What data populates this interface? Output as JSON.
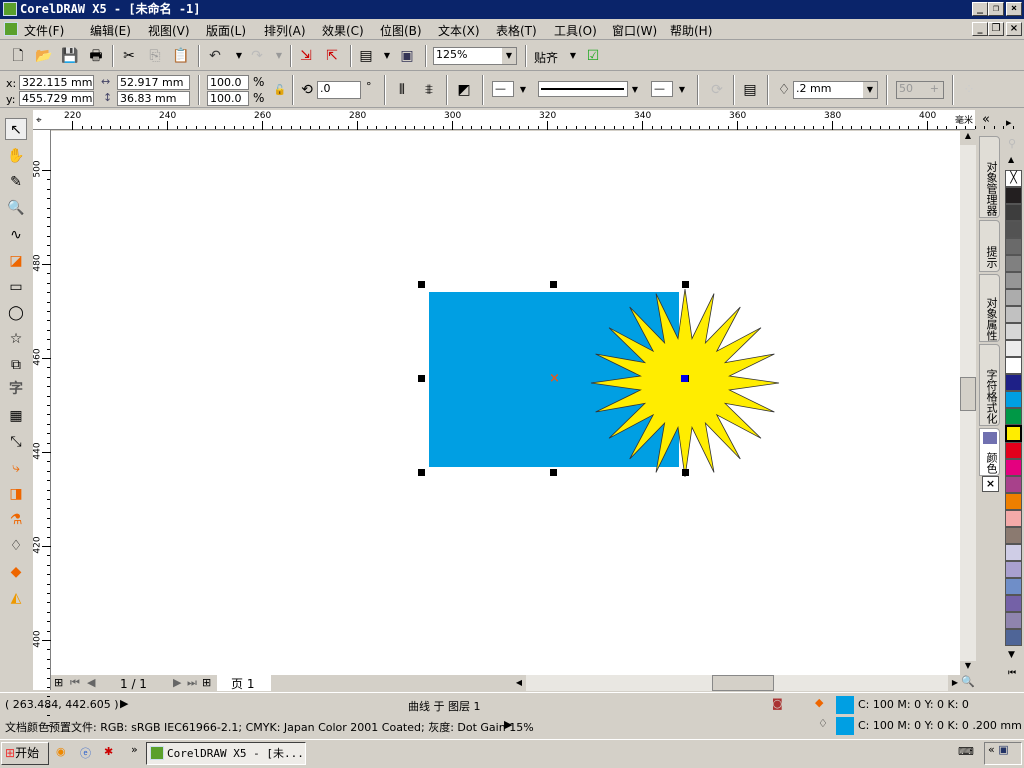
{
  "window": {
    "title": "CorelDRAW X5 - [未命名 -1]"
  },
  "menu": [
    "文件(F)",
    "编辑(E)",
    "视图(V)",
    "版面(L)",
    "排列(A)",
    "效果(C)",
    "位图(B)",
    "文本(X)",
    "表格(T)",
    "工具(O)",
    "窗口(W)",
    "帮助(H)"
  ],
  "toolbar": {
    "zoom": "125%",
    "snap": "贴齐"
  },
  "property_bar": {
    "x_label": "x:",
    "x": "322.115 mm",
    "y_label": "y:",
    "y": "455.729 mm",
    "width": "52.917 mm",
    "height": "36.83 mm",
    "scale_x": "100.0",
    "scale_y": "100.0",
    "pct": "%",
    "rotation": ".0",
    "deg": "°",
    "outline_width": ".2 mm",
    "points": "50"
  },
  "ruler": {
    "unit": "毫米",
    "top_ticks": [
      "220",
      "240",
      "260",
      "280",
      "300",
      "320",
      "340",
      "360",
      "380",
      "400"
    ],
    "left_ticks": [
      "500",
      "480",
      "460",
      "440",
      "420",
      "400"
    ]
  },
  "page_nav": {
    "count": "1 / 1",
    "tab": "页 1"
  },
  "docker_tabs": [
    "对象管理器",
    "提示",
    "对象属性",
    "字符格式化",
    "颜色"
  ],
  "palette": {
    "colors": [
      "#231f20",
      "#3d3d3d",
      "#535353",
      "#6a6a6a",
      "#808080",
      "#969696",
      "#acacac",
      "#c1c1c1",
      "#d7d7d7",
      "#ececec",
      "#ffffff",
      "#1e2087",
      "#009fe3",
      "#009846",
      "#ffed00",
      "#e3001b",
      "#e4007f",
      "#a8418b",
      "#ee7f00",
      "#f4aaa9",
      "#8b7a70",
      "#cfcde6",
      "#a9a0cf",
      "#6f8ec8",
      "#7461a7",
      "#8f84ae",
      "#4f6597"
    ]
  },
  "shapes": {
    "rect_color": "#009fe3",
    "star_color": "#ffed00",
    "star_points": 20
  },
  "status": {
    "coords": "( 263.484, 442.605 )",
    "selection": "曲线 于 图层 1",
    "fill": "C: 100 M: 0 Y: 0 K: 0",
    "outline": "C: 100 M: 0 Y: 0 K: 0  .200 mm",
    "color_profile": "文档颜色预置文件: RGB: sRGB IEC61966-2.1; CMYK: Japan Color 2001 Coated; 灰度: Dot Gain 15%",
    "fill_color": "#009fe3"
  },
  "taskbar": {
    "start": "开始",
    "task": "CorelDRAW X5 - [未..."
  }
}
